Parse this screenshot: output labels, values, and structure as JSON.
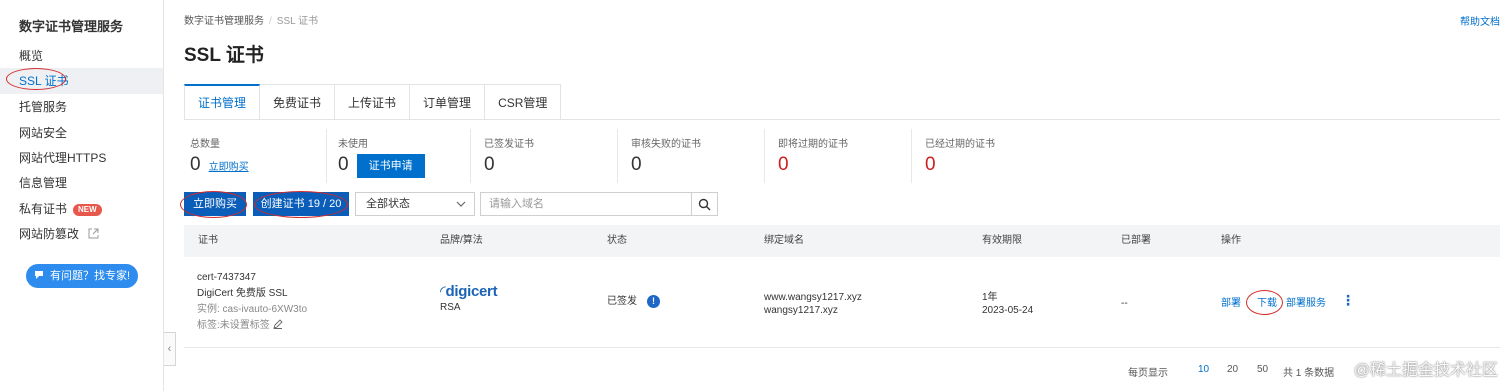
{
  "sidebar": {
    "title": "数字证书管理服务",
    "items": [
      {
        "label": "概览"
      },
      {
        "label": "SSL 证书"
      },
      {
        "label": "托管服务"
      },
      {
        "label": "网站安全"
      },
      {
        "label": "网站代理HTTPS"
      },
      {
        "label": "信息管理"
      },
      {
        "label": "私有证书",
        "badge": "NEW"
      },
      {
        "label": "网站防篡改"
      }
    ],
    "help_button": "有问题？找专家!"
  },
  "header": {
    "breadcrumb": [
      "数字证书管理服务",
      "SSL 证书"
    ],
    "help_doc": "帮助文档",
    "title": "SSL 证书"
  },
  "tabs": [
    "证书管理",
    "免费证书",
    "上传证书",
    "订单管理",
    "CSR管理"
  ],
  "stats": {
    "total": {
      "label": "总数量",
      "value": "0",
      "link": "立即购买"
    },
    "unused": {
      "label": "未使用",
      "value": "0",
      "button": "证书申请"
    },
    "issued": {
      "label": "已签发证书",
      "value": "0"
    },
    "failed": {
      "label": "审核失败的证书",
      "value": "0"
    },
    "expiring": {
      "label": "即将过期的证书",
      "value": "0"
    },
    "expired": {
      "label": "已经过期的证书",
      "value": "0"
    }
  },
  "toolbar": {
    "buy_button": "立即购买",
    "create_button": "创建证书 19 / 20",
    "status_select": "全部状态",
    "search_placeholder": "请输入域名"
  },
  "table": {
    "headers": [
      "证书",
      "品牌/算法",
      "状态",
      "绑定域名",
      "有效期限",
      "已部署",
      "操作"
    ],
    "rows": [
      {
        "cert_id": "cert-7437347",
        "cert_name": "DigiCert 免费版 SSL",
        "instance": "实例: cas-ivauto-6XW3to",
        "tag": "标签:未设置标签",
        "brand": "digicert",
        "algorithm": "RSA",
        "status": "已签发",
        "domains": [
          "www.wangsy1217.xyz",
          "wangsy1217.xyz"
        ],
        "validity": "1年",
        "expiry": "2023-05-24",
        "deployed": "--",
        "actions": [
          "部署",
          "下载",
          "部署服务"
        ]
      }
    ]
  },
  "pagination": {
    "per_page_label": "每页显示",
    "sizes": [
      "10",
      "20",
      "50"
    ],
    "total": "共 1 条数据"
  },
  "watermark": "@稀土掘金技术社区",
  "colors": {
    "accent": "#0070cc",
    "primary_button": "#0a5db8",
    "danger": "#cc1f1f",
    "annotation": "#d42b2b"
  }
}
